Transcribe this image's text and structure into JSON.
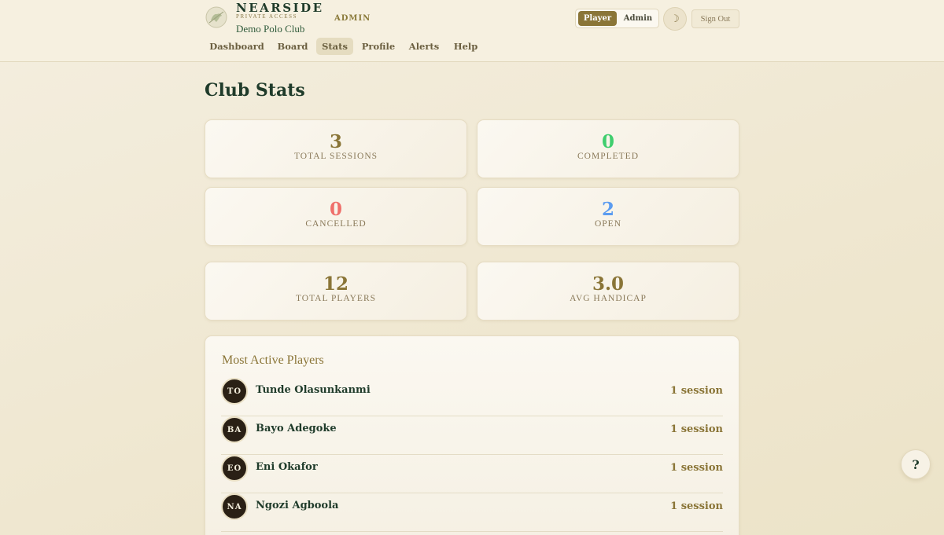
{
  "header": {
    "brand_name": "NEARSIDE",
    "brand_tagline": "PRIVATE ACCESS",
    "club_name": "Demo Polo Club",
    "role_badge": "ADMIN",
    "view_toggle": {
      "player_label": "Player",
      "admin_label": "Admin",
      "selected": "Player"
    },
    "theme_icon": "moon-icon",
    "theme_glyph": "☽",
    "signout_label": "Sign Out",
    "logo_icon": "polo-crest-icon"
  },
  "nav": {
    "tabs": [
      {
        "label": "Dashboard",
        "active": false
      },
      {
        "label": "Board",
        "active": false
      },
      {
        "label": "Stats",
        "active": true
      },
      {
        "label": "Profile",
        "active": false
      },
      {
        "label": "Alerts",
        "active": false
      },
      {
        "label": "Help",
        "active": false
      }
    ]
  },
  "page": {
    "title": "Club Stats"
  },
  "stats": [
    {
      "value": "3",
      "label": "TOTAL SESSIONS",
      "color": "#8a7537"
    },
    {
      "value": "0",
      "label": "COMPLETED",
      "color": "#3fce6e"
    },
    {
      "value": "0",
      "label": "CANCELLED",
      "color": "#ef6f6a"
    },
    {
      "value": "2",
      "label": "OPEN",
      "color": "#5b9cf0"
    },
    {
      "value": "12",
      "label": "TOTAL PLAYERS",
      "color": "#8a7537"
    },
    {
      "value": "3.0",
      "label": "AVG HANDICAP",
      "color": "#8a7537"
    }
  ],
  "most_active": {
    "heading": "Most Active Players",
    "players": [
      {
        "initials": "TO",
        "name": "Tunde Olasunkanmi",
        "sessions": "1 session"
      },
      {
        "initials": "BA",
        "name": "Bayo Adegoke",
        "sessions": "1 session"
      },
      {
        "initials": "EO",
        "name": "Eni Okafor",
        "sessions": "1 session"
      },
      {
        "initials": "NA",
        "name": "Ngozi Agboola",
        "sessions": "1 session"
      }
    ]
  },
  "help_fab": {
    "label": "?"
  },
  "colors": {
    "accent": "#8a7537",
    "brand_green": "#1f3b2a",
    "background": "#f0e9d4"
  }
}
